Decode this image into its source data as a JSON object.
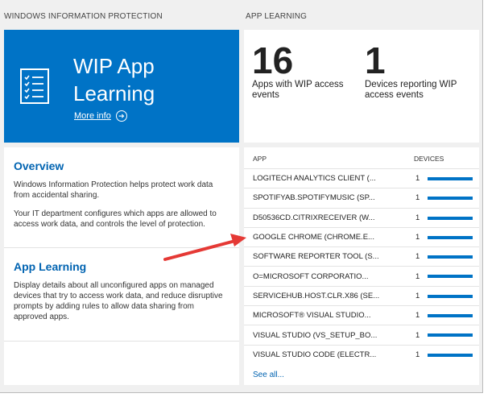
{
  "left_section": {
    "title": "WINDOWS INFORMATION PROTECTION",
    "hero": {
      "title": "WIP App Learning",
      "more_info": "More info"
    },
    "overview": {
      "heading": "Overview",
      "p1": "Windows Information Protection helps protect work data from accidental sharing.",
      "p2": "Your IT department configures which apps are allowed to access work data, and controls the level of protection."
    },
    "app_learning": {
      "heading": "App Learning",
      "p1": "Display details about all unconfigured apps on managed devices that try to access work data, and reduce disruptive prompts by adding rules to allow data sharing from approved apps."
    }
  },
  "right_section": {
    "title": "APP LEARNING",
    "stats": [
      {
        "value": "16",
        "label": "Apps with WIP access events"
      },
      {
        "value": "1",
        "label": "Devices reporting WIP access events"
      }
    ],
    "table": {
      "col_app": "APP",
      "col_devices": "DEVICES",
      "rows": [
        {
          "app": "LOGITECH ANALYTICS CLIENT (...",
          "devices": "1",
          "bar_fraction": 1.0
        },
        {
          "app": "SPOTIFYAB.SPOTIFYMUSIC (SP...",
          "devices": "1",
          "bar_fraction": 1.0
        },
        {
          "app": "D50536CD.CITRIXRECEIVER (W...",
          "devices": "1",
          "bar_fraction": 1.0
        },
        {
          "app": "GOOGLE CHROME (CHROME.E...",
          "devices": "1",
          "bar_fraction": 1.0
        },
        {
          "app": "SOFTWARE REPORTER TOOL (S...",
          "devices": "1",
          "bar_fraction": 1.0
        },
        {
          "app": "O=MICROSOFT CORPORATIO...",
          "devices": "1",
          "bar_fraction": 1.0
        },
        {
          "app": "SERVICEHUB.HOST.CLR.X86 (SE...",
          "devices": "1",
          "bar_fraction": 1.0
        },
        {
          "app": "MICROSOFT® VISUAL STUDIO...",
          "devices": "1",
          "bar_fraction": 1.0
        },
        {
          "app": "VISUAL STUDIO (VS_SETUP_BO...",
          "devices": "1",
          "bar_fraction": 1.0
        },
        {
          "app": "VISUAL STUDIO CODE (ELECTR...",
          "devices": "1",
          "bar_fraction": 1.0
        }
      ],
      "see_all": "See all..."
    }
  },
  "colors": {
    "accent": "#0073c6",
    "link": "#0063b1",
    "callout": "#e53935"
  },
  "icons": {
    "hero": "checklist-document-icon",
    "more": "arrow-circle-right-icon",
    "annotation": "red-arrow-icon"
  }
}
